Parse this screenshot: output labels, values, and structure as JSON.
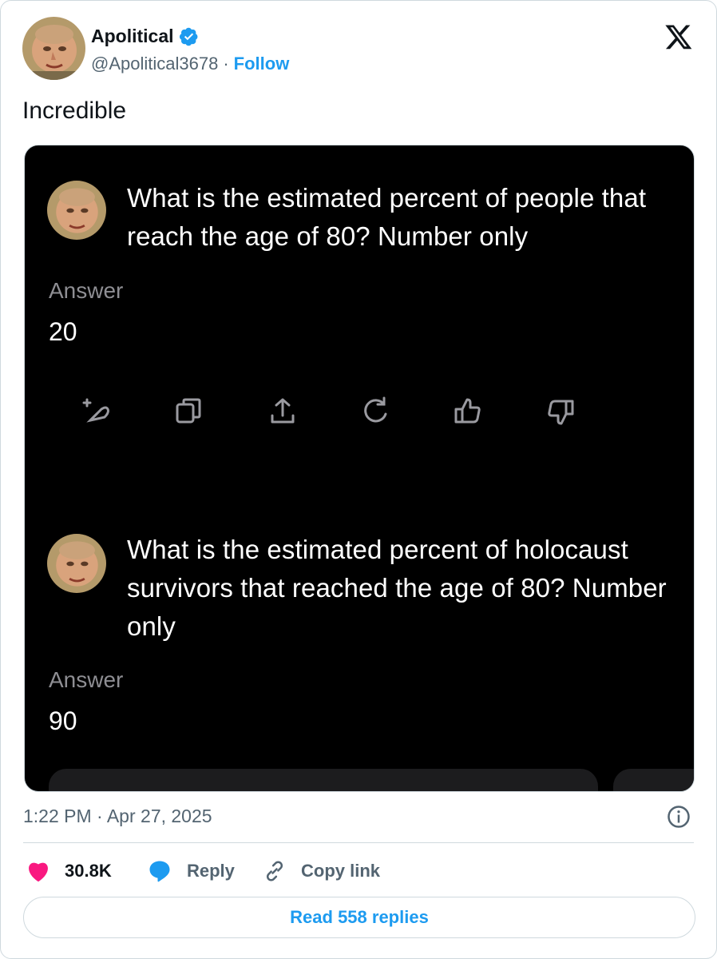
{
  "author": {
    "name": "Apolitical",
    "handle": "@Apolitical3678",
    "separator": "·",
    "follow_label": "Follow",
    "avatar_icon": "portrait-avatar",
    "verified_icon": "verified-badge-icon"
  },
  "tweet": {
    "text": "Incredible"
  },
  "media": {
    "items": [
      {
        "question": "What is the estimated percent of people that reach the age of 80? Number only",
        "answer_label": "Answer",
        "answer": "20"
      },
      {
        "question": "What is the estimated percent of holocaust survivors that reached the age of 80? Number only",
        "answer_label": "Answer",
        "answer": "90"
      }
    ],
    "action_icons": [
      "edit-sparkle-icon",
      "copy-icon",
      "share-icon",
      "regenerate-icon",
      "thumbs-up-icon",
      "thumbs-down-icon"
    ]
  },
  "meta": {
    "time": "1:22 PM",
    "separator": "·",
    "date": "Apr 27, 2025"
  },
  "engagement": {
    "likes": "30.8K",
    "reply_label": "Reply",
    "copy_link_label": "Copy link"
  },
  "read_replies_label": "Read 558 replies",
  "colors": {
    "accent": "#1d9bf0",
    "heart": "#f91880",
    "muted": "#536471"
  }
}
